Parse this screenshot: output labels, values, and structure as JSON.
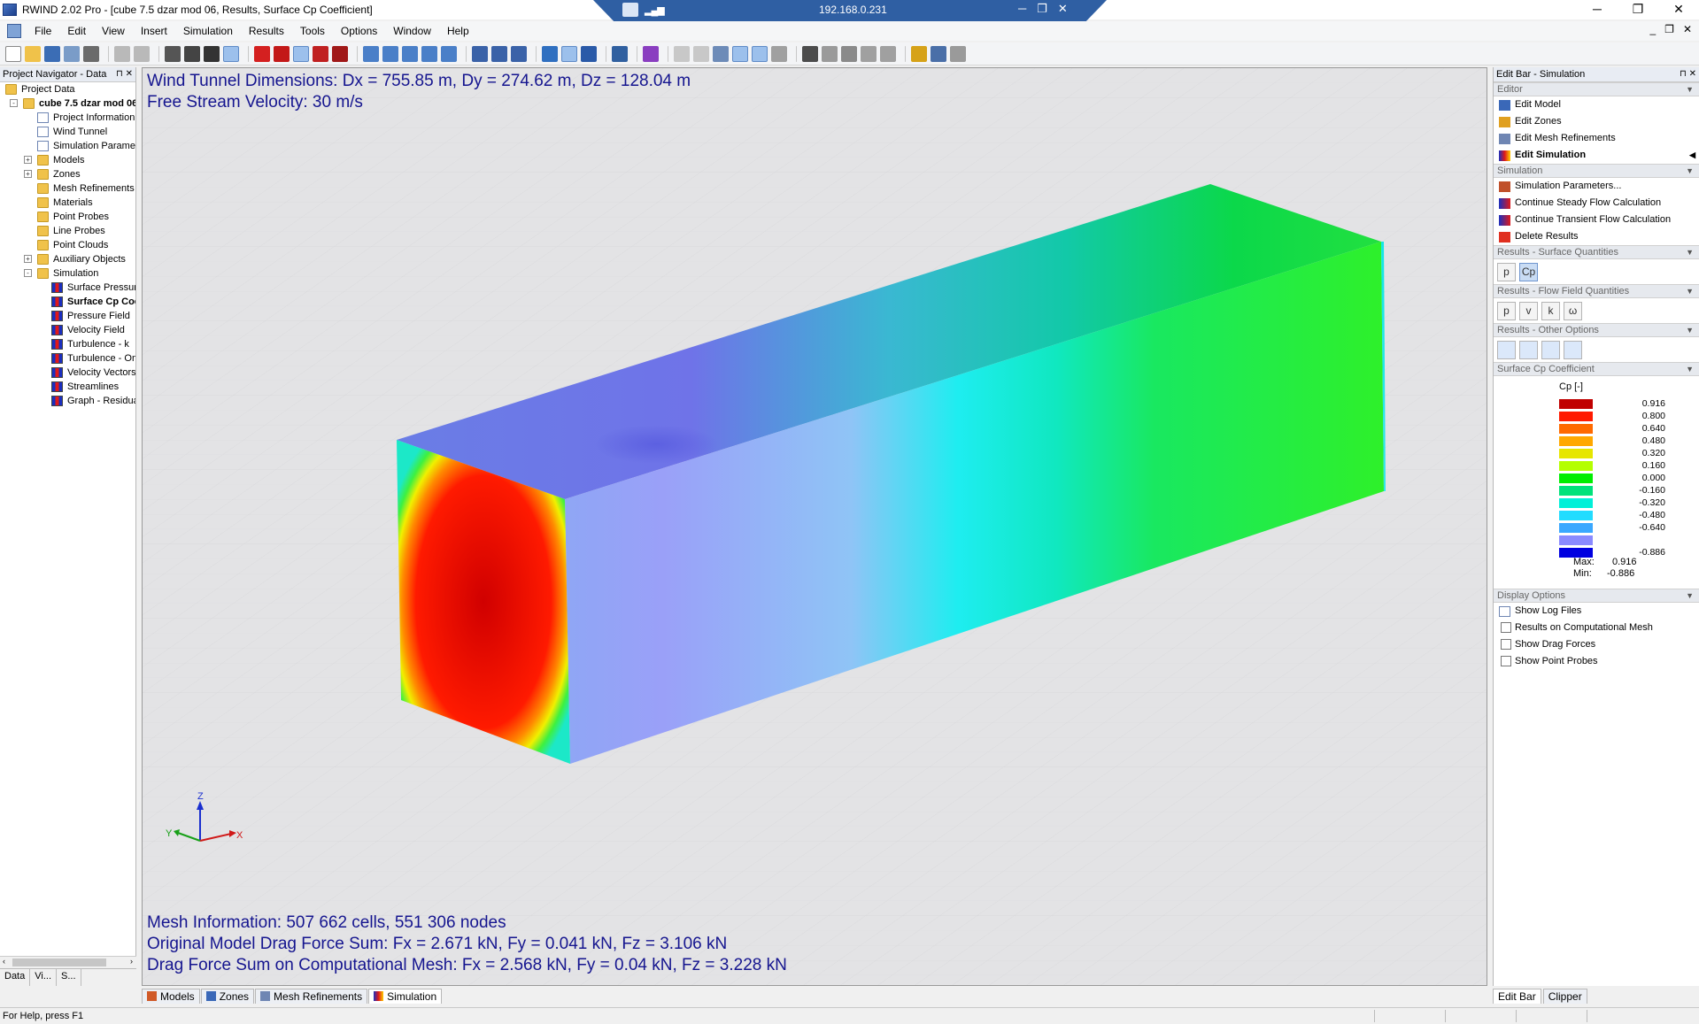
{
  "window": {
    "title": "RWIND 2.02 Pro - [cube 7.5 dzar mod 06, Results, Surface Cp Coefficient]",
    "remote_ip": "192.168.0.231"
  },
  "menu": [
    "File",
    "Edit",
    "View",
    "Insert",
    "Simulation",
    "Results",
    "Tools",
    "Options",
    "Window",
    "Help"
  ],
  "navigator": {
    "header": "Project Navigator - Data",
    "items": [
      {
        "label": "Project Data",
        "level": 0,
        "icon": "folder-icon"
      },
      {
        "label": "cube 7.5 dzar mod 06",
        "level": 1,
        "icon": "folder-icon",
        "bold": true,
        "expand": "-"
      },
      {
        "label": "Project Information",
        "level": 2,
        "icon": "page-icon"
      },
      {
        "label": "Wind Tunnel",
        "level": 2,
        "icon": "page-icon"
      },
      {
        "label": "Simulation Parameters",
        "level": 2,
        "icon": "page-icon"
      },
      {
        "label": "Models",
        "level": 2,
        "icon": "folder-icon",
        "expand": "+"
      },
      {
        "label": "Zones",
        "level": 2,
        "icon": "folder-icon",
        "expand": "+"
      },
      {
        "label": "Mesh Refinements",
        "level": 2,
        "icon": "folder-icon"
      },
      {
        "label": "Materials",
        "level": 2,
        "icon": "folder-icon"
      },
      {
        "label": "Point Probes",
        "level": 2,
        "icon": "folder-icon"
      },
      {
        "label": "Line Probes",
        "level": 2,
        "icon": "folder-icon"
      },
      {
        "label": "Point Clouds",
        "level": 2,
        "icon": "folder-icon"
      },
      {
        "label": "Auxiliary Objects",
        "level": 2,
        "icon": "folder-icon",
        "expand": "+"
      },
      {
        "label": "Simulation",
        "level": 2,
        "icon": "folder-icon",
        "expand": "-"
      },
      {
        "label": "Surface Pressure",
        "level": 3,
        "icon": "result-icon"
      },
      {
        "label": "Surface Cp Coefficient",
        "level": 3,
        "icon": "result-icon",
        "bold": true
      },
      {
        "label": "Pressure Field",
        "level": 3,
        "icon": "result-icon"
      },
      {
        "label": "Velocity Field",
        "level": 3,
        "icon": "result-icon"
      },
      {
        "label": "Turbulence - k",
        "level": 3,
        "icon": "result-icon"
      },
      {
        "label": "Turbulence - Omega",
        "level": 3,
        "icon": "result-icon"
      },
      {
        "label": "Velocity Vectors",
        "level": 3,
        "icon": "result-icon"
      },
      {
        "label": "Streamlines",
        "level": 3,
        "icon": "result-icon"
      },
      {
        "label": "Graph - Residuals",
        "level": 3,
        "icon": "result-icon"
      }
    ],
    "tabs": [
      "Data",
      "Vi...",
      "S..."
    ]
  },
  "viewport": {
    "line1": "Wind Tunnel Dimensions: Dx = 755.85 m, Dy = 274.62 m, Dz = 128.04 m",
    "line2": "Free Stream Velocity: 30 m/s",
    "mesh_info": "Mesh Information: 507 662 cells, 551 306 nodes",
    "drag_original": "Original Model Drag Force Sum: Fx = 2.671 kN, Fy = 0.041 kN, Fz = 3.106 kN",
    "drag_comp": "Drag Force Sum on Computational Mesh: Fx = 2.568 kN, Fy = 0.04 kN, Fz = 3.228 kN",
    "axes": {
      "x": "X",
      "y": "Y",
      "z": "Z"
    }
  },
  "doc_tabs": [
    "Models",
    "Zones",
    "Mesh Refinements",
    "Simulation"
  ],
  "editbar": {
    "header": "Edit Bar - Simulation",
    "editor_title": "Editor",
    "editor_items": [
      "Edit Model",
      "Edit Zones",
      "Edit Mesh Refinements",
      "Edit Simulation"
    ],
    "simulation_title": "Simulation",
    "simulation_items": [
      "Simulation Parameters...",
      "Continue Steady Flow Calculation",
      "Continue Transient Flow Calculation",
      "Delete Results"
    ],
    "surface_title": "Results - Surface Quantities",
    "surface_buttons": [
      "p",
      "Cp"
    ],
    "flow_title": "Results - Flow Field Quantities",
    "flow_buttons": [
      "p",
      "v",
      "k",
      "ω"
    ],
    "other_title": "Results - Other Options",
    "cp_title": "Surface Cp Coefficient",
    "legend_unit": "Cp [-]",
    "legend": [
      {
        "value": "0.916",
        "color": "#c00000"
      },
      {
        "value": "0.800",
        "color": "#ff1a00"
      },
      {
        "value": "0.640",
        "color": "#ff6a00"
      },
      {
        "value": "0.480",
        "color": "#ffa800"
      },
      {
        "value": "0.320",
        "color": "#e6e600"
      },
      {
        "value": "0.160",
        "color": "#b4ff00"
      },
      {
        "value": "0.000",
        "color": "#00ee00"
      },
      {
        "value": "-0.160",
        "color": "#00e27a"
      },
      {
        "value": "-0.320",
        "color": "#00f0d8"
      },
      {
        "value": "-0.480",
        "color": "#22dcff"
      },
      {
        "value": "-0.640",
        "color": "#3aa8ff"
      },
      {
        "value": "",
        "color": "#8a8aff"
      },
      {
        "value": "-0.886",
        "color": "#0000e0"
      }
    ],
    "max_label": "Max:",
    "max_value": "0.916",
    "min_label": "Min:",
    "min_value": "-0.886",
    "display_title": "Display Options",
    "display_items": [
      "Show Log Files",
      "Results on Computational Mesh",
      "Show Drag Forces",
      "Show Point Probes"
    ],
    "tabs": [
      "Edit Bar",
      "Clipper"
    ]
  },
  "status": "For Help, press F1"
}
